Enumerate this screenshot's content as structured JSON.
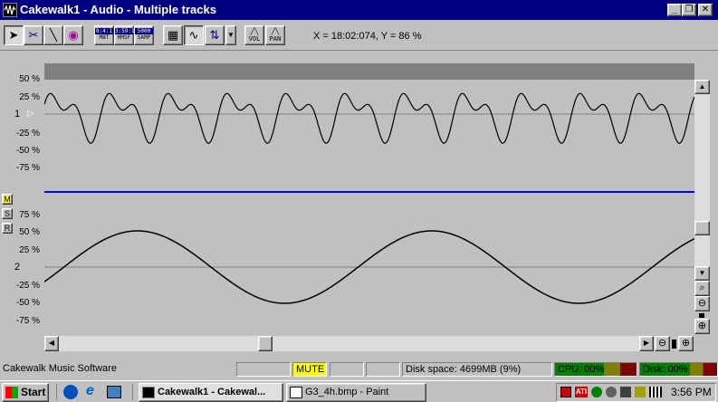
{
  "window": {
    "title": "Cakewalk1 - Audio - Multiple tracks"
  },
  "toolbar": {
    "readout": "X = 18:02:074, Y = 86 %",
    "mbt": [
      "8:4:1",
      "MBT"
    ],
    "hmsf": [
      "3:59:1",
      "HMSF"
    ],
    "samp": [
      "5000",
      "SAMP"
    ],
    "vol": "VOL",
    "pan": "PAN"
  },
  "tracks": [
    {
      "number": "1",
      "labels": [
        "25 %",
        "-25 %",
        "-50 %",
        "-75 %"
      ],
      "top_label": "50 %"
    },
    {
      "number": "2",
      "labels": [
        "75 %",
        "50 %",
        "25 %",
        "-25 %",
        "-50 %",
        "-75 %"
      ]
    }
  ],
  "track_buttons": {
    "mute": "M",
    "solo": "S",
    "record": "R"
  },
  "status": {
    "app": "Cakewalk Music Software",
    "mute": "MUTE",
    "disk_space": "Disk space: 4699MB (9%)",
    "cpu": "CPU: 00%",
    "disk": "Disk: 00%"
  },
  "taskbar": {
    "start": "Start",
    "tasks": [
      "Cakewalk1 - Cakewal...",
      "G3_4h.bmp - Paint"
    ],
    "clock": "3:56 PM"
  },
  "colors": {
    "title": "#000080",
    "divider": "#0000ff",
    "mute_yellow": "#ffff00",
    "cpu_green": "#008000"
  }
}
